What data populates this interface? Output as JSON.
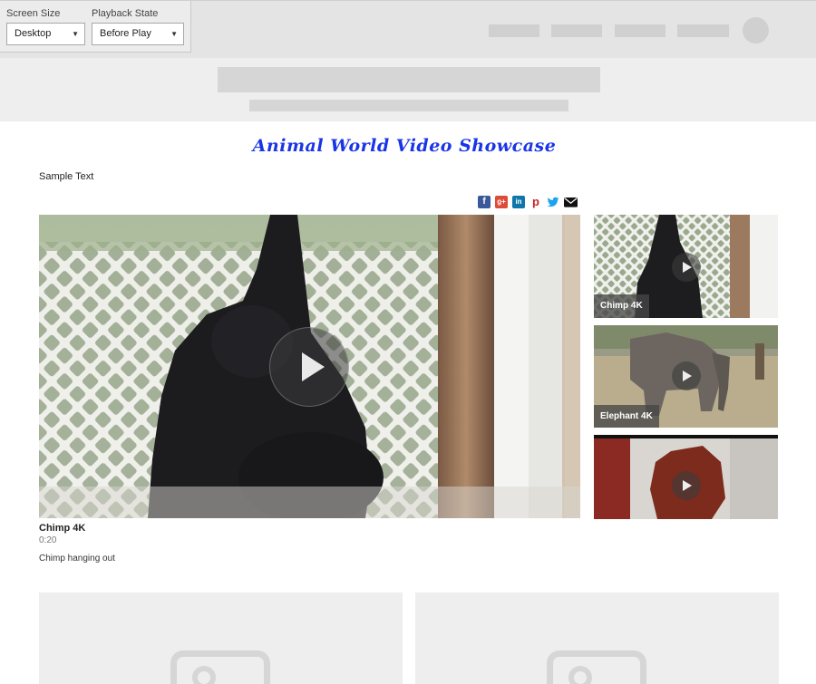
{
  "controls": {
    "screen_size": {
      "label": "Screen Size",
      "value": "Desktop"
    },
    "playback_state": {
      "label": "Playback State",
      "value": "Before Play"
    }
  },
  "icons": {
    "caret": "▼",
    "facebook": "f",
    "google_plus": "g+",
    "linkedin": "in",
    "pinterest": "p"
  },
  "page": {
    "title": "Animal World Video Showcase",
    "sample_text": "Sample Text"
  },
  "main_video": {
    "title": "Chimp 4K",
    "duration": "0:20",
    "description": "Chimp hanging out"
  },
  "playlist": [
    {
      "label": "Chimp 4K"
    },
    {
      "label": "Elephant 4K"
    },
    {
      "label": ""
    }
  ],
  "colors": {
    "title": "#1a35e6",
    "facebook": "#3b5998",
    "google_plus": "#dd4b39",
    "linkedin": "#0e76a8",
    "pinterest": "#cb2027",
    "twitter": "#1da1f2",
    "placeholder": "#d6d6d6"
  }
}
